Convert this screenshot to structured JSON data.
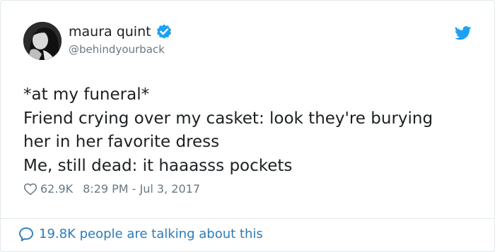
{
  "author": {
    "name": "maura quint",
    "handle": "@behindyourback",
    "verified": true
  },
  "tweet": {
    "lines": [
      "*at my funeral*",
      "Friend crying over my casket: look they're burying",
      "her in her favorite dress",
      "Me, still dead: it haaasss pockets"
    ]
  },
  "meta": {
    "likes": "62.9K",
    "timestamp": "8:29 PM - Jul 3, 2017"
  },
  "footer": {
    "talking": "19.8K people are talking about this"
  },
  "icons": {
    "verified": "verified-badge-icon",
    "brand": "twitter-bird-icon",
    "like": "heart-outline-icon",
    "reply": "speech-bubble-icon"
  },
  "colors": {
    "text": "#1c2022",
    "muted": "#697882",
    "link": "#2b7bb9",
    "twitter_blue": "#1da1f2",
    "border": "#e1e8ed"
  }
}
